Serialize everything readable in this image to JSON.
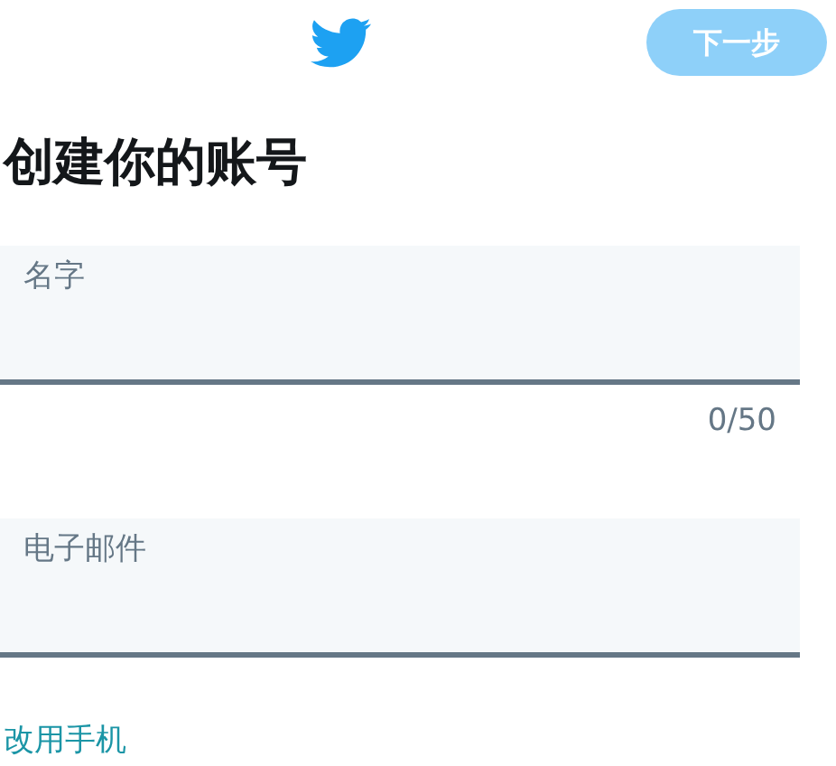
{
  "header": {
    "next_button": {
      "label": "下一步",
      "disabled": true
    }
  },
  "title": "创建你的账号",
  "fields": [
    {
      "placeholder": "名字",
      "counter": "0/50"
    },
    {
      "placeholder": "电子邮件"
    }
  ],
  "switch_link": "改用手机"
}
